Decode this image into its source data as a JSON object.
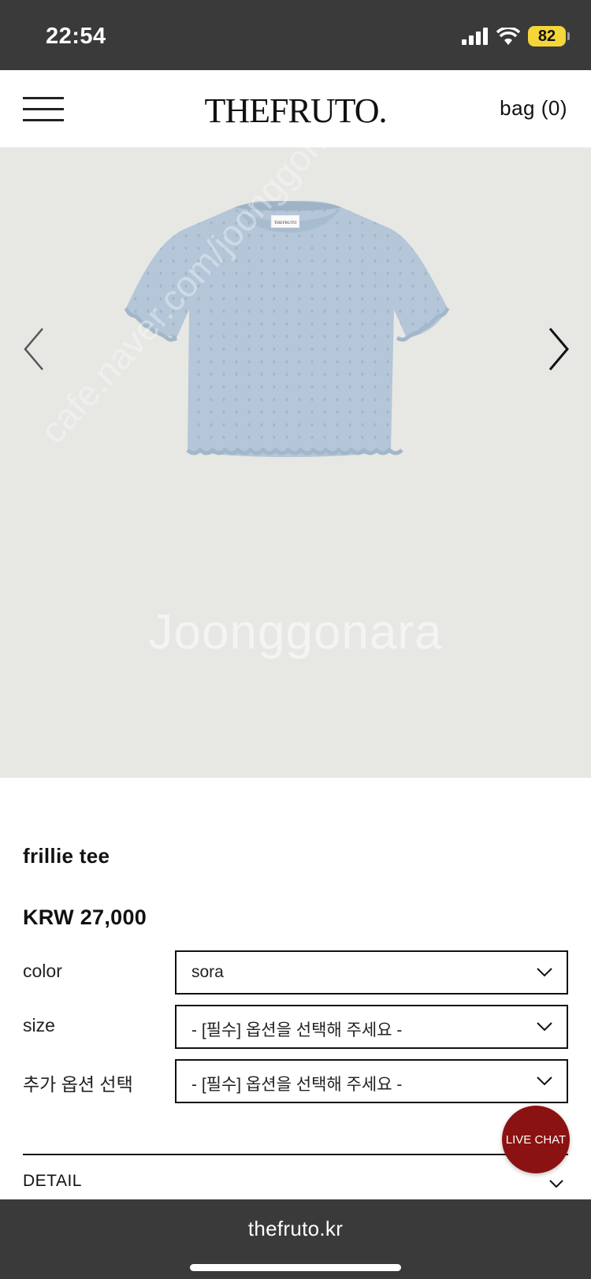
{
  "status_bar": {
    "time": "22:54",
    "battery": "82"
  },
  "header": {
    "logo": "THEFRUTO.",
    "bag": "bag (0)"
  },
  "gallery": {
    "tag_label": "THEFRUTO",
    "watermark": "Joonggonara",
    "watermark_url": "cafe.naver.com/joonggonara"
  },
  "product": {
    "name": "frillie tee",
    "price": "KRW 27,000",
    "options": [
      {
        "label": "color",
        "value": "sora"
      },
      {
        "label": "size",
        "value": "- [필수] 옵션을 선택해 주세요 -"
      },
      {
        "label": "추가 옵션 선택",
        "value": "- [필수] 옵션을 선택해 주세요 -"
      }
    ]
  },
  "detail_label": "DETAIL",
  "live_chat": "LIVE CHAT",
  "browser": {
    "url": "thefruto.kr"
  },
  "colors": {
    "gallery_bg": "#e7e8e3",
    "tee": "#b4c6d8",
    "live_chat": "#8b1212",
    "bars": "#3a3a3a"
  }
}
